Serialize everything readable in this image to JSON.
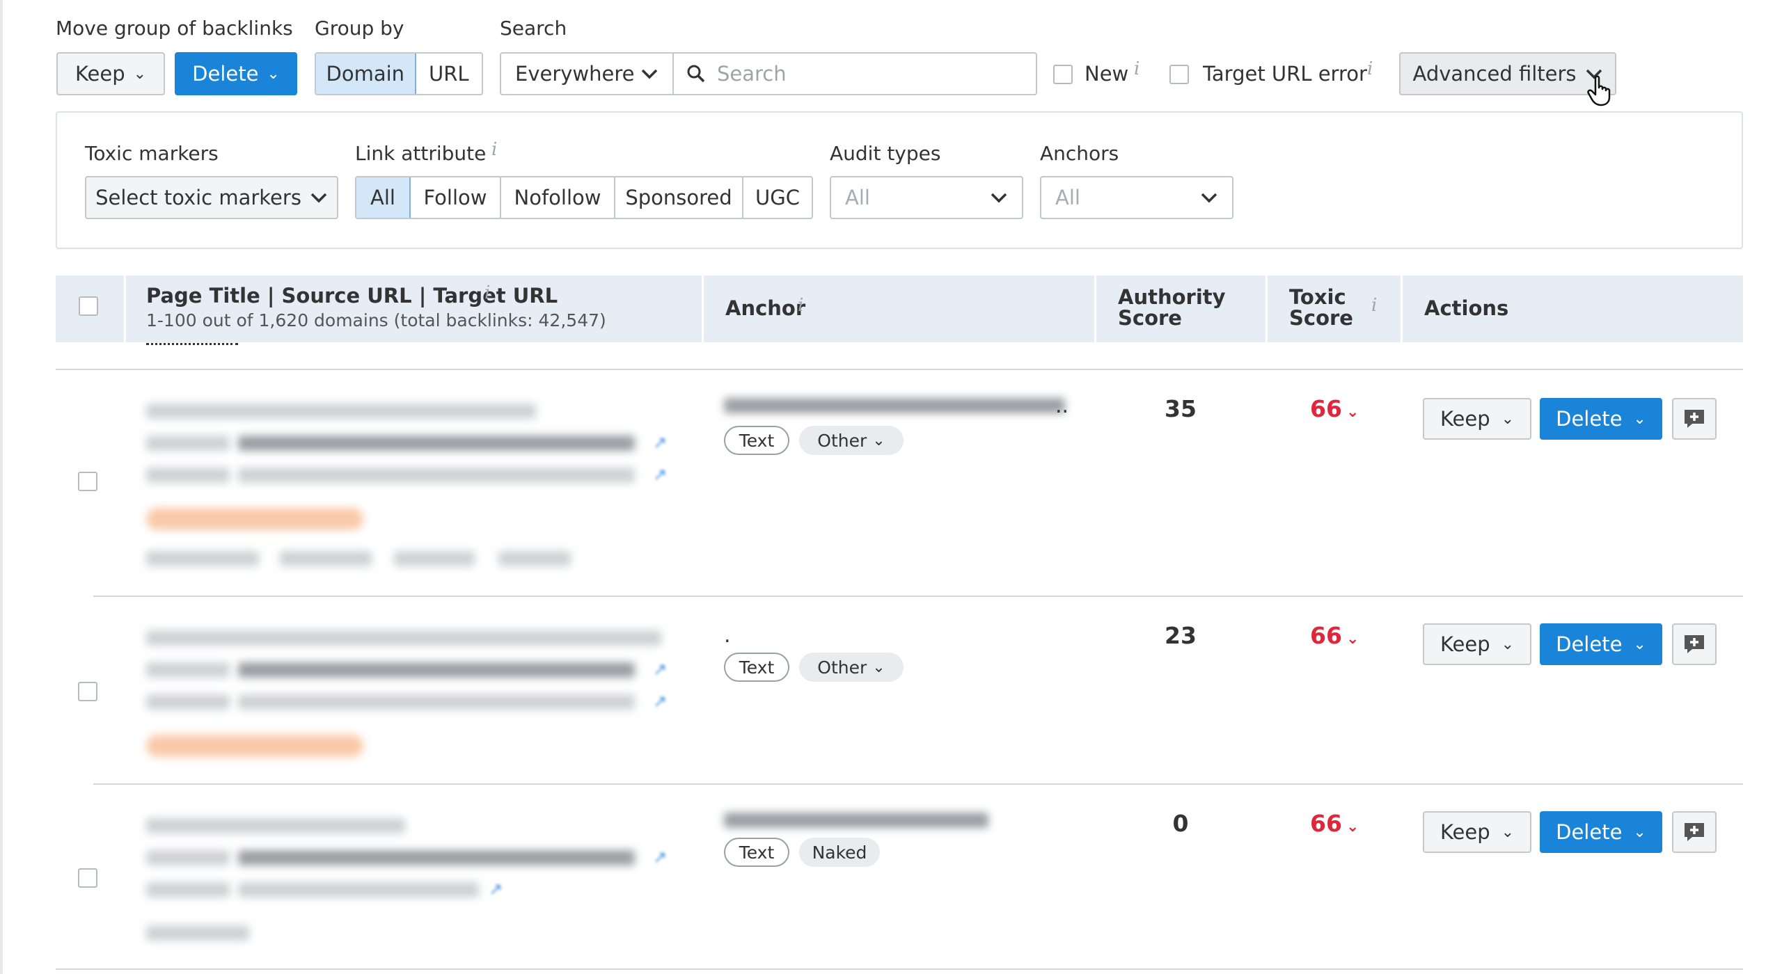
{
  "toolbar": {
    "move_group_label": "Move group of backlinks",
    "keep_label": "Keep",
    "delete_label": "Delete",
    "group_by_label": "Group by",
    "group_by_options": [
      "Domain",
      "URL"
    ],
    "group_by_selected": "Domain",
    "search_label": "Search",
    "search_scope": "Everywhere",
    "search_placeholder": "Search",
    "new_label": "New",
    "target_url_error_label": "Target URL error",
    "advanced_filters_label": "Advanced filters"
  },
  "filters": {
    "toxic_markers_label": "Toxic markers",
    "toxic_markers_placeholder": "Select toxic markers",
    "link_attribute_label": "Link attribute",
    "link_attribute_options": [
      "All",
      "Follow",
      "Nofollow",
      "Sponsored",
      "UGC"
    ],
    "link_attribute_selected": "All",
    "audit_types_label": "Audit types",
    "audit_types_value": "All",
    "anchors_label": "Anchors",
    "anchors_value": "All"
  },
  "table": {
    "col_title": "Page Title | Source URL | Target URL",
    "col_title_sub": "1-100 out of 1,620 domains (total backlinks: 42,547)",
    "col_anchor": "Anchor",
    "col_authority_line1": "Authority",
    "col_authority_line2": "Score",
    "col_toxic_line1": "Toxic",
    "col_toxic_line2": "Score",
    "col_actions": "Actions",
    "rows": [
      {
        "anchor_tail": "..",
        "tags": [
          "Text",
          "Other"
        ],
        "authority": "35",
        "toxic": "66"
      },
      {
        "anchor_tail": ".",
        "tags": [
          "Text",
          "Other"
        ],
        "authority": "23",
        "toxic": "66"
      },
      {
        "anchor_tail": "",
        "tags": [
          "Text",
          "Naked"
        ],
        "authority": "0",
        "toxic": "66"
      }
    ],
    "row_keep_label": "Keep",
    "row_delete_label": "Delete"
  },
  "colors": {
    "accent": "#1a84d8",
    "toxic": "#e0263b",
    "header_bg": "#e6edf5"
  }
}
